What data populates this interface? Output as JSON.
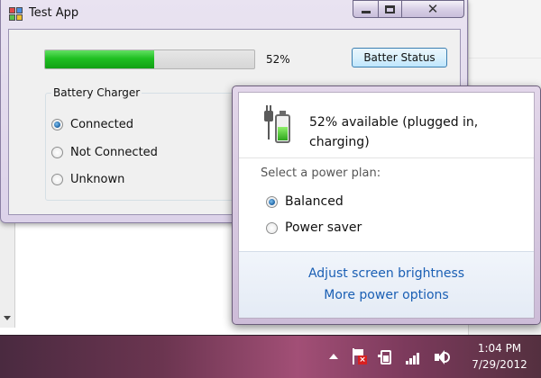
{
  "window": {
    "title": "Test App",
    "progress": {
      "percent": 52,
      "label": "52%"
    },
    "status_button_label": "Batter Status",
    "group": {
      "title": "Battery Charger",
      "options": [
        "Connected",
        "Not Connected",
        "Unknown"
      ],
      "selected": "Connected"
    }
  },
  "battery_flyout": {
    "status_line1": "52% available (plugged in,",
    "status_line2": "charging)",
    "plan_label": "Select a power plan:",
    "plans": [
      "Balanced",
      "Power saver"
    ],
    "selected_plan": "Balanced",
    "links": [
      "Adjust screen brightness",
      "More power options"
    ]
  },
  "taskbar": {
    "time": "1:04 PM",
    "date": "7/29/2012",
    "tray_icons": [
      "show-hidden-icons-chevron",
      "action-center-flag-icon",
      "battery-icon",
      "network-signal-icon",
      "volume-icon"
    ]
  },
  "colors": {
    "progress_fill": "#1fbf22",
    "link": "#1a5fb4",
    "battery_charge": "#2ea61d"
  }
}
